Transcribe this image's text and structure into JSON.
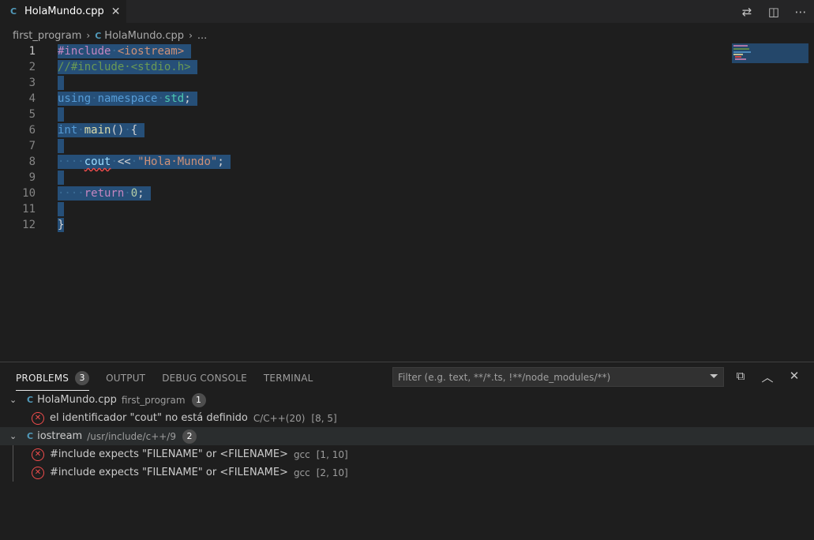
{
  "tab": {
    "icon": "C",
    "name": "HolaMundo.cpp",
    "close": "✕"
  },
  "tab_actions": [
    "⇄",
    "◫",
    "⋯"
  ],
  "breadcrumb": {
    "folder": "first_program",
    "icon": "C",
    "file": "HolaMundo.cpp",
    "more": "..."
  },
  "editor": {
    "line_numbers": [
      "1",
      "2",
      "3",
      "4",
      "5",
      "6",
      "7",
      "8",
      "9",
      "10",
      "11",
      "12"
    ]
  },
  "panel": {
    "tabs": {
      "problems": "PROBLEMS",
      "problems_count": "3",
      "output": "OUTPUT",
      "debug": "DEBUG CONSOLE",
      "terminal": "TERMINAL"
    },
    "filter_placeholder": "Filter (e.g. text, **/*.ts, !**/node_modules/**)",
    "groups": [
      {
        "file": "HolaMundo.cpp",
        "path": "first_program",
        "count": "1"
      },
      {
        "file": "iostream",
        "path": "/usr/include/c++/9",
        "count": "2"
      }
    ],
    "problems": [
      {
        "message": "el identificador \"cout\" no está definido",
        "source": "C/C++(20)",
        "position": "[8, 5]"
      },
      {
        "message": "#include expects \"FILENAME\" or <FILENAME>",
        "source": "gcc",
        "position": "[1, 10]"
      },
      {
        "message": "#include expects \"FILENAME\" or <FILENAME>",
        "source": "gcc",
        "position": "[2, 10]"
      }
    ]
  },
  "colors": {
    "selection": "#264f78",
    "error": "#f14c4c",
    "background": "#1e1e1e"
  }
}
